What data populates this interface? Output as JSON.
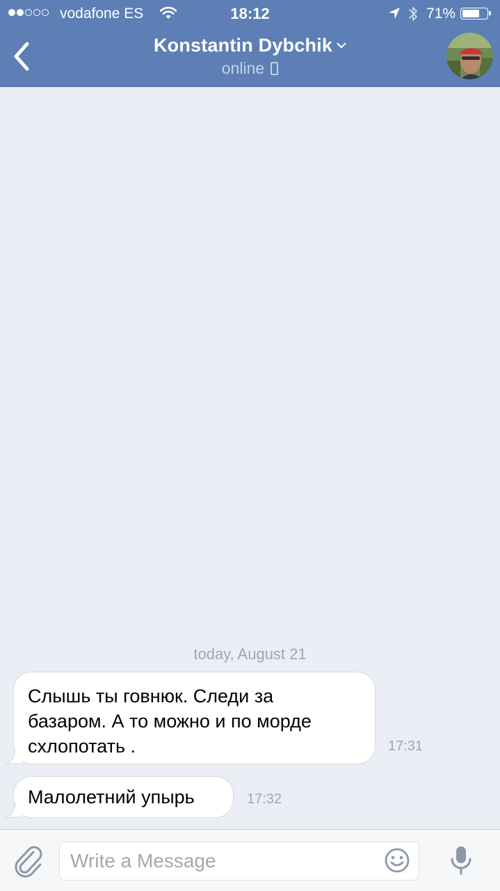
{
  "status_bar": {
    "carrier": "vodafone ES",
    "time": "18:12",
    "battery_percent": "71%",
    "battery_level": 0.71,
    "signal_bars_filled": 2,
    "signal_bars_total": 5
  },
  "header": {
    "contact_name": "Konstantin Dybchik",
    "status": "online",
    "accent_color": "#5d7fb5"
  },
  "chat": {
    "date_divider": "today, August 21",
    "messages": [
      {
        "lines": [
          "Слышь ты говнюк. Следи за",
          "базаром. А то можно и по морде",
          "схлопотать ."
        ],
        "time": "17:31"
      },
      {
        "lines": [
          "Малолетний упырь"
        ],
        "time": "17:32"
      }
    ]
  },
  "composer": {
    "placeholder": "Write a Message"
  },
  "icons": {
    "back": "back-chevron-icon",
    "title_toggle": "chevron-down-icon",
    "device": "phone-icon",
    "attach": "paperclip-icon",
    "emoji": "smiley-icon",
    "voice": "microphone-icon",
    "wifi": "wifi-icon",
    "location": "location-arrow-icon",
    "bluetooth": "bluetooth-icon",
    "battery": "battery-icon"
  }
}
